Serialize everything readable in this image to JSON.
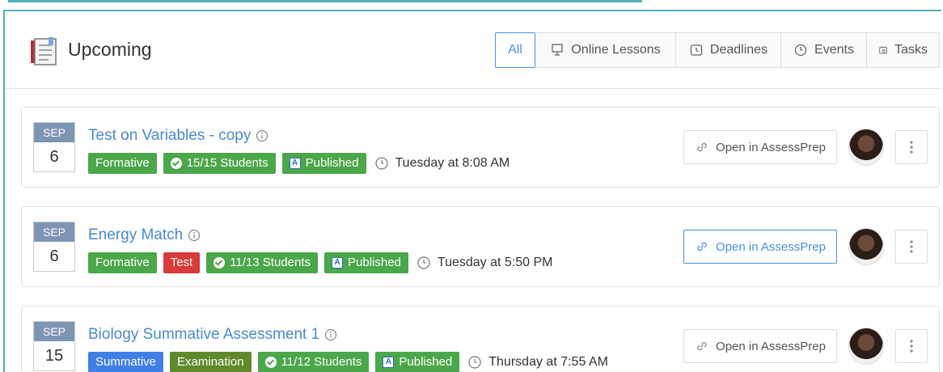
{
  "header": {
    "title": "Upcoming",
    "filters": [
      "All",
      "Online Lessons",
      "Deadlines",
      "Events",
      "Tasks"
    ],
    "active_filter": "All"
  },
  "colors": {
    "accent_teal": "#4fb0b8",
    "link_blue": "#4a8ad0",
    "date_header": "#7d95b5",
    "green": "#4aa74a",
    "red": "#d93a3a",
    "olive": "#5f8a2a",
    "blue": "#3f7fe6"
  },
  "items": [
    {
      "month": "SEP",
      "day": "6",
      "title": "Test on Variables - copy",
      "badges": {
        "b1": "Formative",
        "students": "15/15 Students",
        "published": "Published"
      },
      "time": "Tuesday at 8:08 AM",
      "open_label": "Open in AssessPrep"
    },
    {
      "month": "SEP",
      "day": "6",
      "title": "Energy Match",
      "badges": {
        "b1": "Formative",
        "b2": "Test",
        "students": "11/13 Students",
        "published": "Published"
      },
      "time": "Tuesday at 5:50 PM",
      "open_label": "Open in AssessPrep"
    },
    {
      "month": "SEP",
      "day": "15",
      "title": "Biology Summative Assessment 1",
      "badges": {
        "b1": "Summative",
        "b2": "Examination",
        "students": "11/12 Students",
        "published": "Published"
      },
      "time": "Thursday at 7:55 AM",
      "open_label": "Open in AssessPrep"
    }
  ],
  "icons": {
    "header": "notebook-icon",
    "online_lessons": "presentation-icon",
    "deadlines": "calendar-clock-icon",
    "events": "clock-icon",
    "tasks": "calendar-task-icon",
    "info": "info-icon",
    "check": "check-circle-icon",
    "published": "assessprep-icon",
    "time": "clock-icon",
    "link": "link-icon",
    "more": "kebab-icon"
  }
}
